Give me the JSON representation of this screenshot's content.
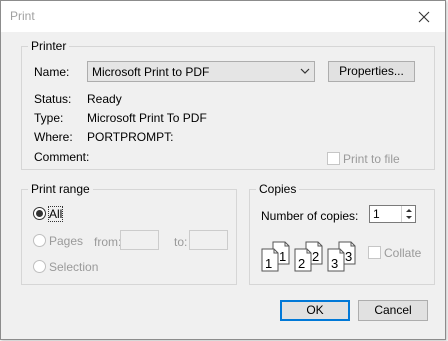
{
  "window": {
    "title": "Print",
    "close_icon": "close-icon"
  },
  "printer": {
    "legend": "Printer",
    "name_label": "Name:",
    "name_value": "Microsoft Print to PDF",
    "properties_label": "Properties...",
    "status_label": "Status:",
    "status_value": "Ready",
    "type_label": "Type:",
    "type_value": "Microsoft Print To PDF",
    "where_label": "Where:",
    "where_value": "PORTPROMPT:",
    "comment_label": "Comment:",
    "print_to_file_label": "Print to file"
  },
  "print_range": {
    "legend": "Print range",
    "all_label": "All",
    "pages_label": "Pages",
    "from_label": "from:",
    "to_label": "to:",
    "selection_label": "Selection",
    "selected": "All"
  },
  "copies": {
    "legend": "Copies",
    "number_label": "Number of copies:",
    "number_value": "1",
    "collate_label": "Collate",
    "collate_icon": "collate-pages-icon",
    "page_numbers": [
      "1",
      "1",
      "2",
      "2",
      "3",
      "3"
    ]
  },
  "buttons": {
    "ok_label": "OK",
    "cancel_label": "Cancel"
  },
  "colors": {
    "accent": "#0078d7",
    "dialog_bg": "#f0f0f0",
    "disabled_text": "#9a9a9a"
  }
}
